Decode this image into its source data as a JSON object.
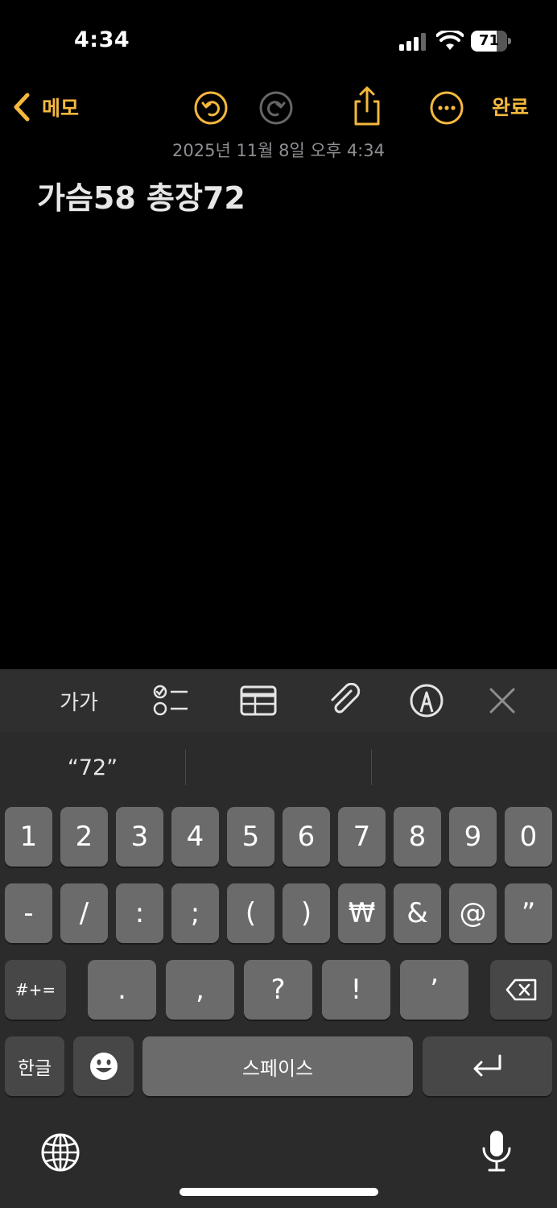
{
  "status_bar": {
    "time": "4:34",
    "battery": "71",
    "battery_level": 0.71
  },
  "nav": {
    "back_label": "메모",
    "done_label": "완료"
  },
  "note": {
    "date": "2025년 11월 8일 오후 4:34",
    "title": "가슴58 총장72"
  },
  "toolbar": {
    "format_label": "가가"
  },
  "keyboard": {
    "suggestions": [
      "“72”",
      "",
      ""
    ],
    "row1": [
      "1",
      "2",
      "3",
      "4",
      "5",
      "6",
      "7",
      "8",
      "9",
      "0"
    ],
    "row2": [
      "-",
      "/",
      ":",
      ";",
      "(",
      ")",
      "₩",
      "&",
      "@",
      "”"
    ],
    "row3": [
      "#+=",
      ".",
      ",",
      "?",
      "!",
      "’"
    ],
    "hangul_label": "한글",
    "space_label": "스페이스"
  },
  "colors": {
    "accent": "#f5b83d",
    "background": "#000000",
    "keyboard_bg": "#2b2b2b",
    "key": "#6b6b6b",
    "key_dark": "#474747"
  },
  "icons": [
    "chevron-left-icon",
    "undo-icon",
    "redo-icon",
    "share-icon",
    "more-icon",
    "checklist-icon",
    "table-icon",
    "paperclip-icon",
    "markup-icon",
    "close-icon",
    "delete-icon",
    "emoji-icon",
    "return-icon",
    "globe-icon",
    "mic-icon"
  ]
}
